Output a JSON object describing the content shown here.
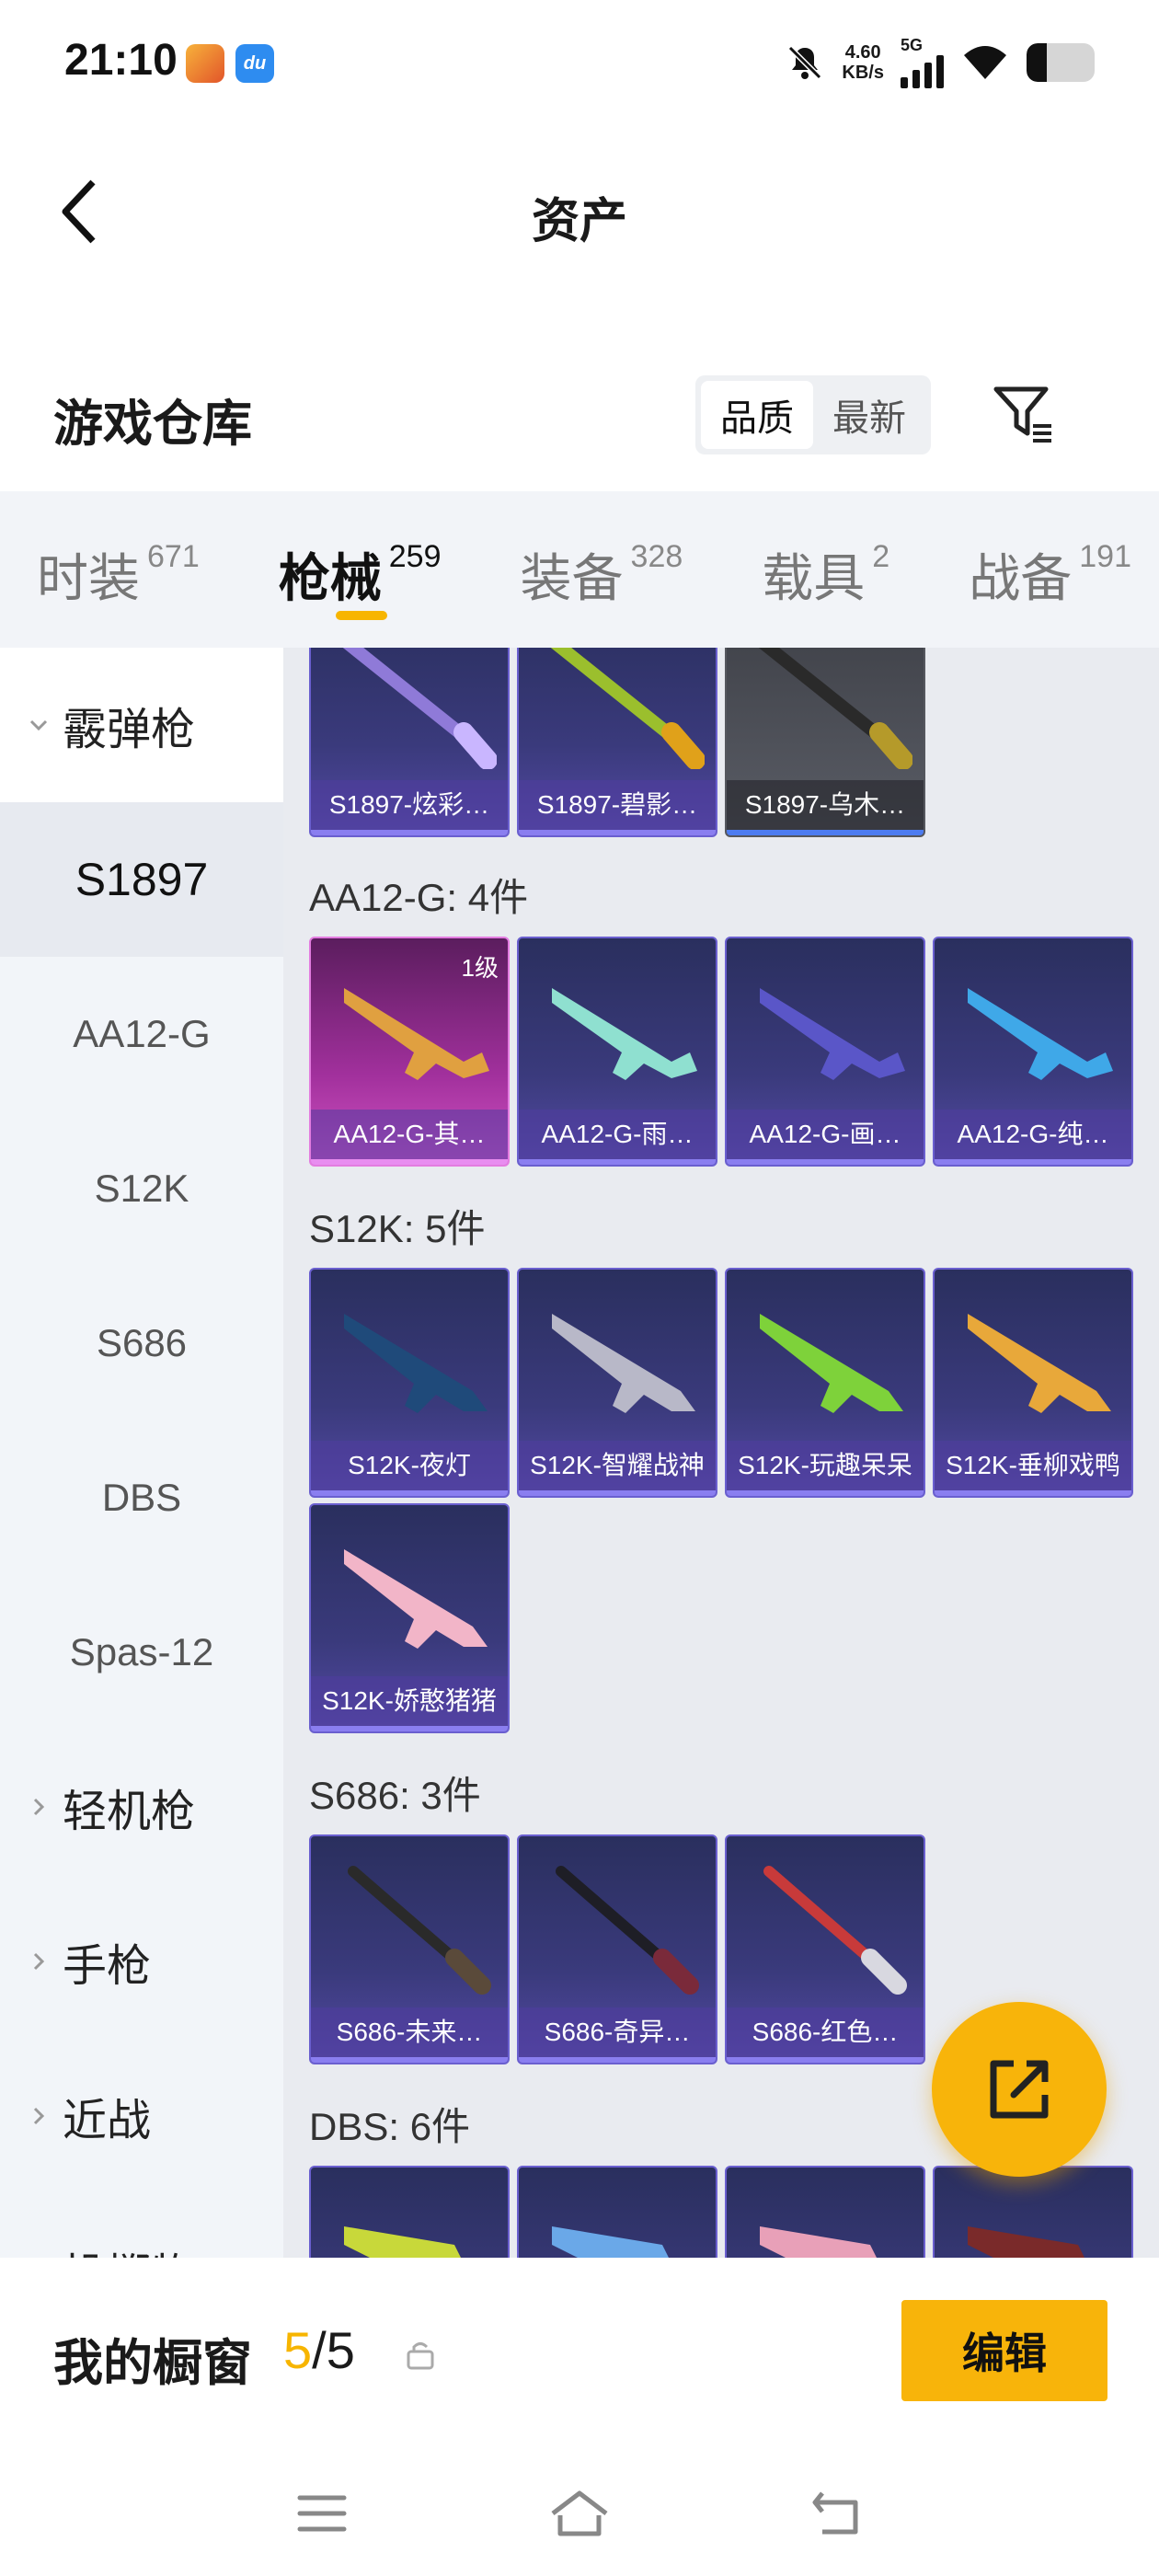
{
  "status_bar": {
    "time": "21:10",
    "speed_value": "4.60",
    "speed_unit": "KB/s",
    "network": "5G"
  },
  "header": {
    "title": "资产"
  },
  "section": {
    "title": "游戏仓库",
    "sort_options": [
      "品质",
      "最新"
    ],
    "active_sort": "品质"
  },
  "tabs": [
    {
      "label": "时装",
      "count": "671"
    },
    {
      "label": "枪械",
      "count": "259"
    },
    {
      "label": "装备",
      "count": "328"
    },
    {
      "label": "载具",
      "count": "2"
    },
    {
      "label": "战备",
      "count": "191"
    }
  ],
  "sidebar": {
    "group_shotgun": "霰弹枪",
    "items": [
      "S1897",
      "AA12-G",
      "S12K",
      "S686",
      "DBS",
      "Spas-12"
    ],
    "selected": "S1897",
    "groups": [
      "轻机枪",
      "手枪",
      "近战",
      "投掷物"
    ]
  },
  "content": {
    "s1897_cards": [
      "S1897-炫彩…",
      "S1897-碧影…",
      "S1897-乌木…"
    ],
    "aa12_heading": "AA12-G: 4件",
    "aa12_cards": [
      "AA12-G-其…",
      "AA12-G-雨…",
      "AA12-G-画…",
      "AA12-G-纯…"
    ],
    "aa12_level": "1级",
    "s12k_heading": "S12K: 5件",
    "s12k_cards": [
      "S12K-夜灯",
      "S12K-智耀战神",
      "S12K-玩趣呆呆",
      "S12K-垂柳戏鸭",
      "S12K-娇憨猪猪"
    ],
    "s686_heading": "S686: 3件",
    "s686_cards": [
      "S686-未来…",
      "S686-奇异…",
      "S686-红色…"
    ],
    "dbs_heading": "DBS: 6件"
  },
  "bottom": {
    "showcase_label": "我的橱窗",
    "count_current": "5",
    "count_sep": "/",
    "count_total": "5",
    "edit_label": "编辑"
  },
  "colors": {
    "accent": "#f8b40a",
    "card_purple": "#3a3a7c",
    "card_pink": "#a1309c"
  },
  "icons": [
    "back-arrow-icon",
    "filter-icon",
    "share-export-icon",
    "lock-icon",
    "menu-icon",
    "home-icon",
    "return-icon"
  ]
}
